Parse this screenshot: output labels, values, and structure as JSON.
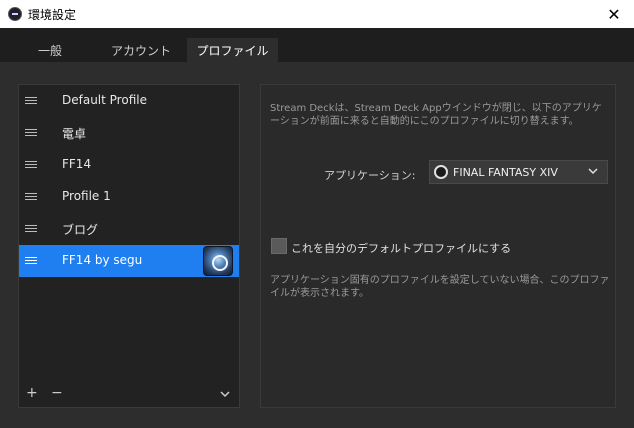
{
  "window": {
    "title": "環境設定"
  },
  "tabs": [
    {
      "label": "一般"
    },
    {
      "label": "アカウント"
    },
    {
      "label": "プロファイル"
    }
  ],
  "profiles": [
    {
      "label": "Default Profile"
    },
    {
      "label": "電卓"
    },
    {
      "label": "FF14"
    },
    {
      "label": "Profile 1"
    },
    {
      "label": "ブログ"
    },
    {
      "label": "FF14 by segu"
    }
  ],
  "profile_footer": {
    "add": "+",
    "remove": "−"
  },
  "settings": {
    "description": "Stream Deckは、Stream Deck Appウインドウが閉じ、以下のアプリケーションが前面に来ると自動的にこのプロファイルに切り替えます。",
    "application_label": "アプリケーション:",
    "application_value": "FINAL FANTASY XIV",
    "default_checkbox_label": "これを自分のデフォルトプロファイルにする",
    "note": "アプリケーション固有のプロファイルを設定していない場合、このプロファイルが表示されます。"
  },
  "colors": {
    "accent": "#1f7ef0",
    "background": "#2d2d2d"
  }
}
